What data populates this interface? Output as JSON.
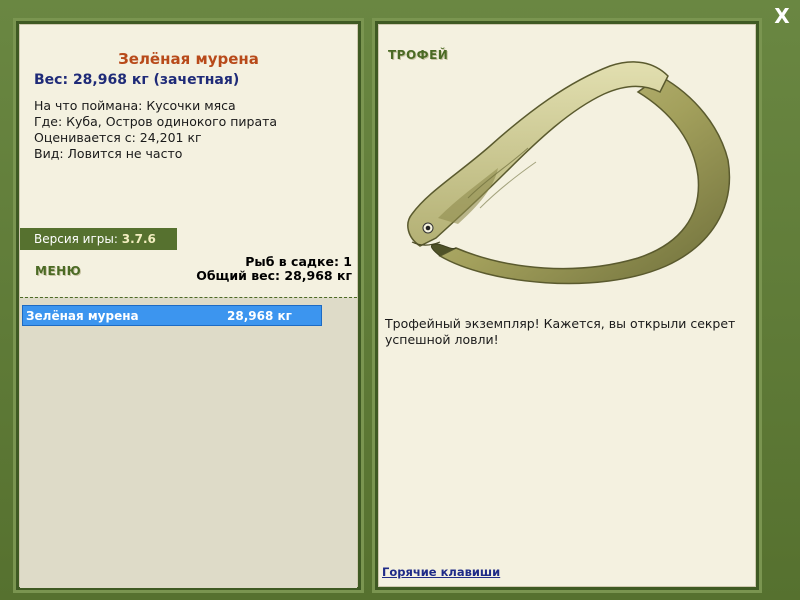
{
  "window": {
    "close_label": "X"
  },
  "fish": {
    "name": "Зелёная мурена",
    "weight_line": "Вес: 28,968 кг (зачетная)",
    "bait_line": "На что поймана: Кусочки мяса",
    "location_line": "Где: Куба, Остров одинокого пирата",
    "rated_line": "Оценивается с: 24,201 кг",
    "kind_line": "Вид: Ловится не часто"
  },
  "version": {
    "label": "Версия игры:",
    "value": "3.7.6"
  },
  "menu": {
    "label": "МЕНЮ"
  },
  "keepnet": {
    "count_line": "Рыб в садке: 1",
    "total_line": "Общий вес: 28,968 кг",
    "items": [
      {
        "name": "Зелёная мурена",
        "weight": "28,968 кг"
      }
    ]
  },
  "trophy": {
    "label": "ТРОФЕЙ",
    "text": "Трофейный экземпляр! Кажется, вы открыли секрет успешной ловли!"
  },
  "hotkeys": {
    "label": "Горячие клавиши"
  },
  "colors": {
    "frame_green": "#5e7a3a",
    "panel_bg": "#f4f1e0",
    "title_orange": "#b84a1a",
    "weight_blue": "#1f2b78",
    "selected_row": "#3c95ef"
  }
}
